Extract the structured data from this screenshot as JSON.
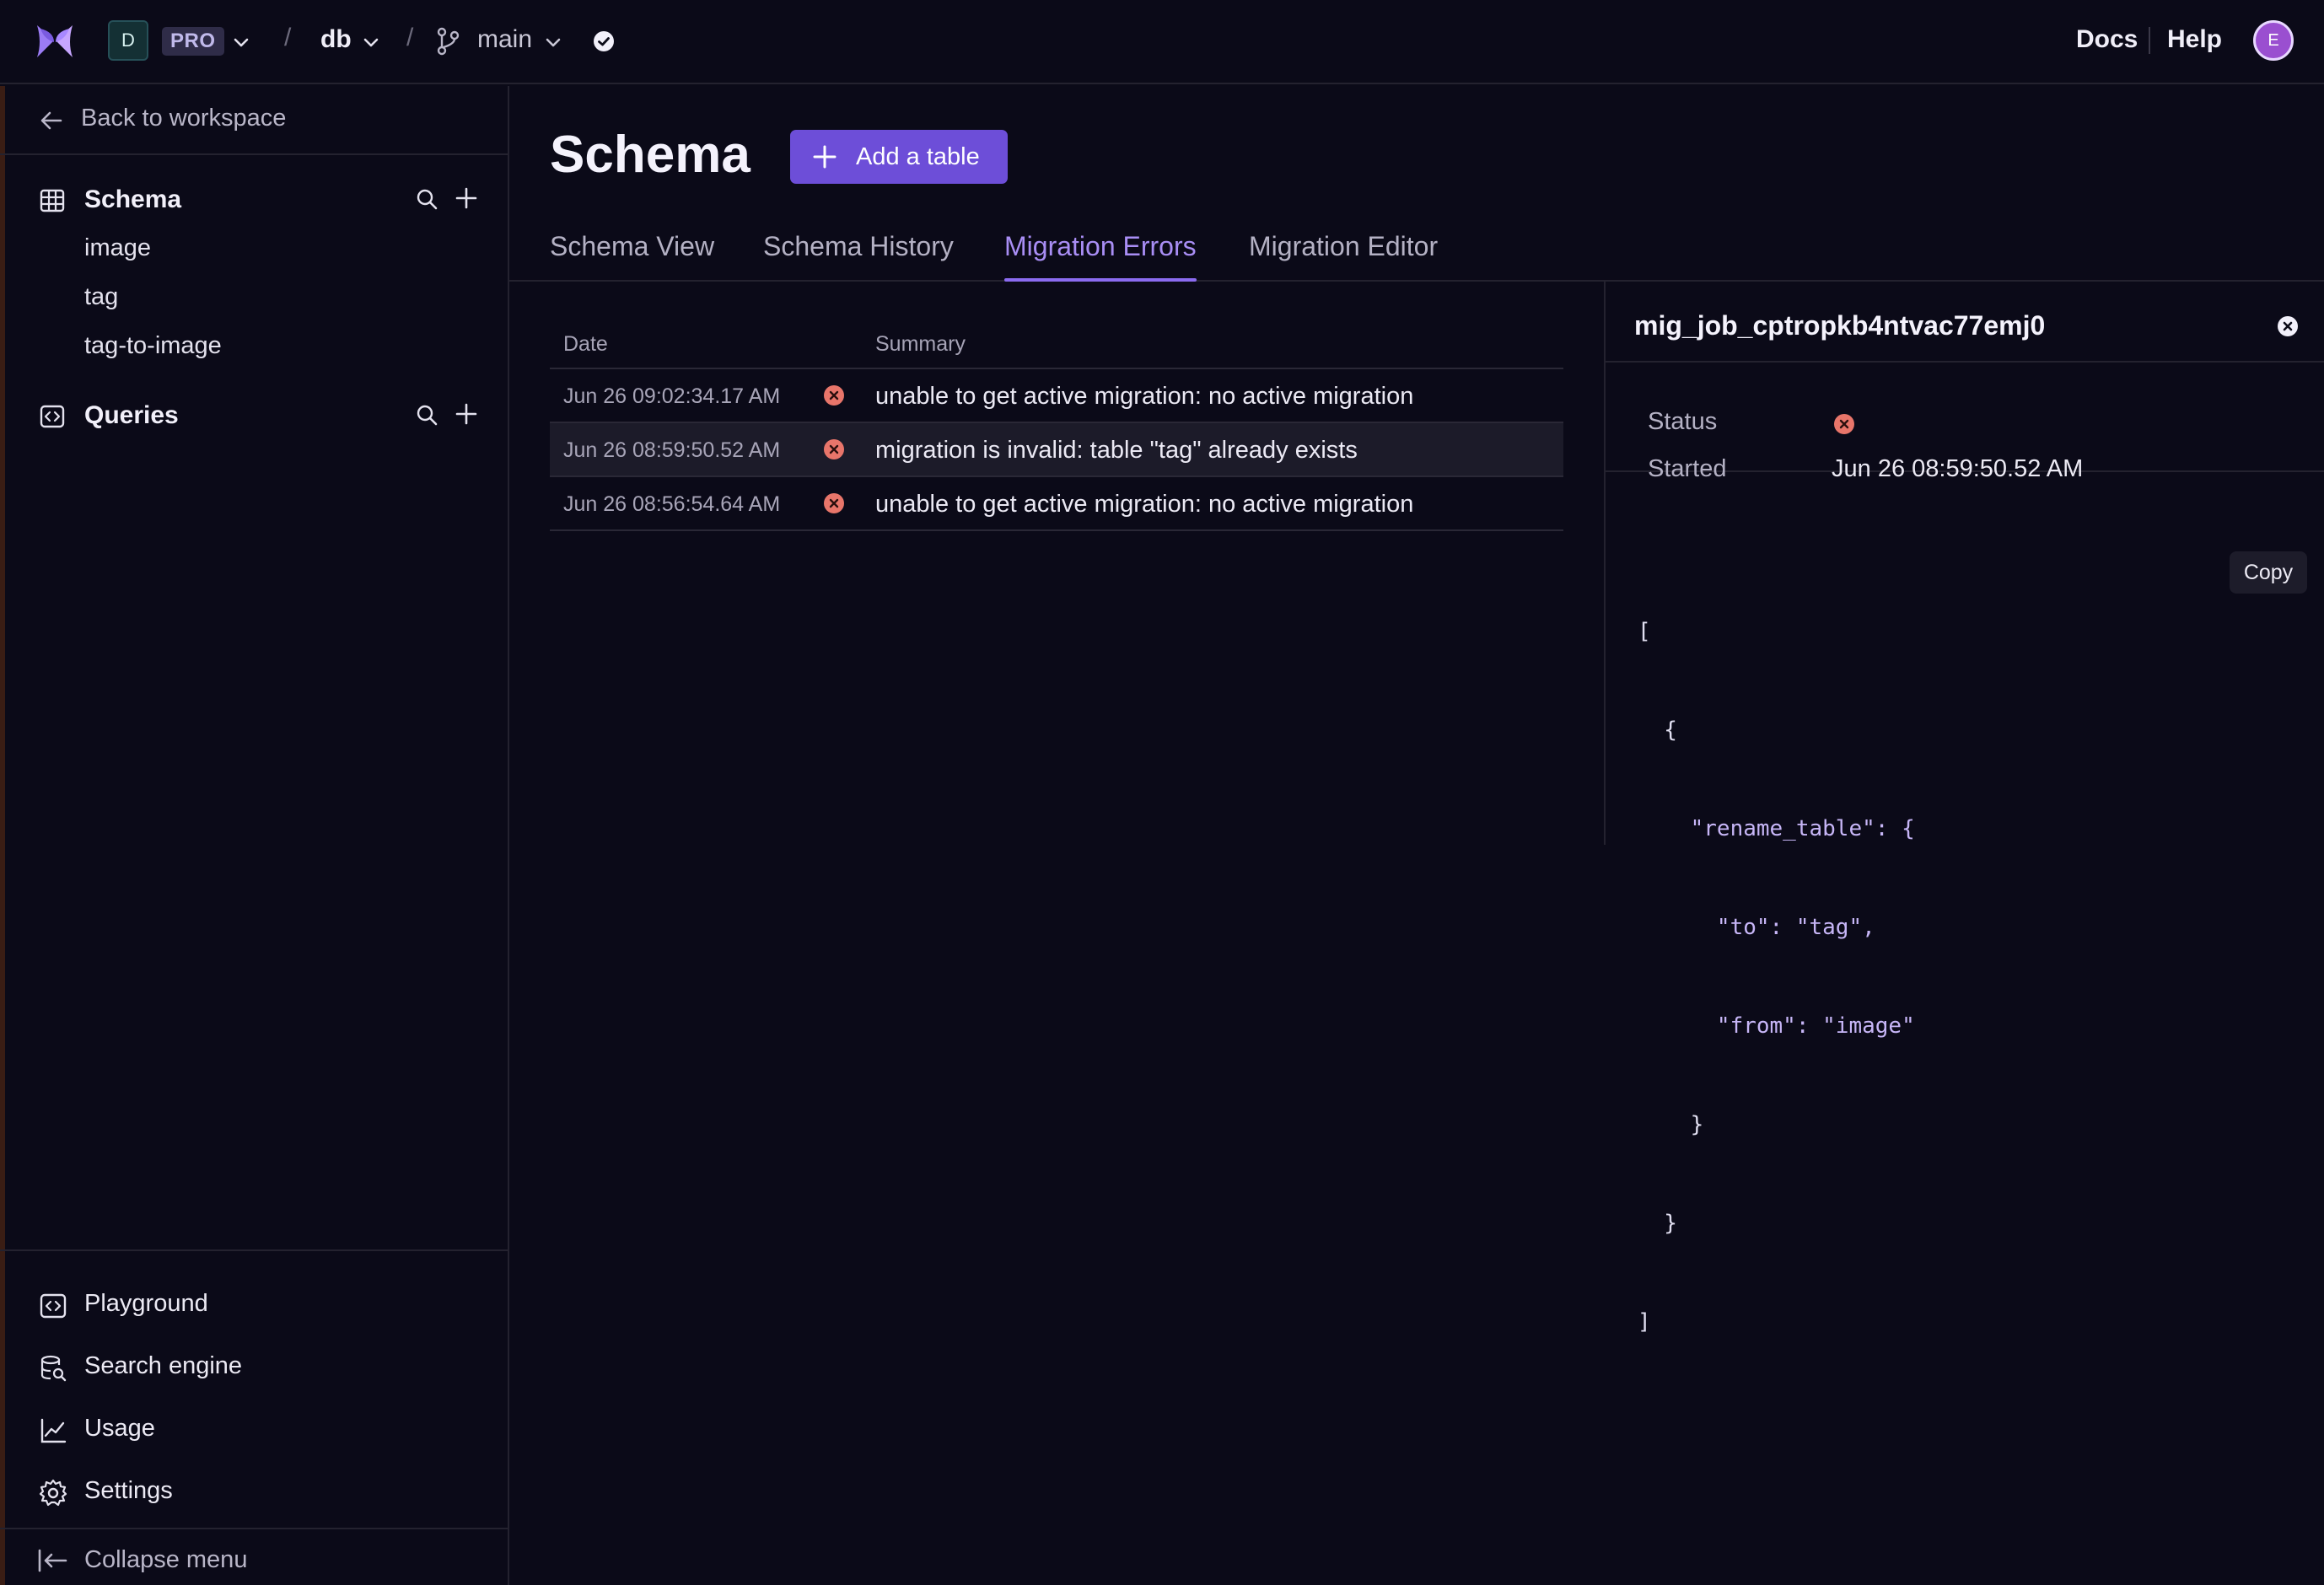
{
  "topbar": {
    "workspace_initial": "D",
    "plan_badge": "PRO",
    "database": "db",
    "branch": "main",
    "docs_label": "Docs",
    "help_label": "Help",
    "avatar_initial": "E",
    "separator": "/"
  },
  "sidebar": {
    "back_label": "Back to workspace",
    "schema": {
      "label": "Schema",
      "tables": [
        "image",
        "tag",
        "tag-to-image"
      ]
    },
    "queries": {
      "label": "Queries"
    },
    "bottom_nav": [
      {
        "label": "Playground",
        "icon": "code-box-icon"
      },
      {
        "label": "Search engine",
        "icon": "db-search-icon"
      },
      {
        "label": "Usage",
        "icon": "chart-line-icon"
      },
      {
        "label": "Settings",
        "icon": "gear-icon"
      }
    ],
    "collapse_label": "Collapse menu"
  },
  "main": {
    "title": "Schema",
    "add_table_label": "Add a table",
    "tabs": [
      {
        "label": "Schema View",
        "active": false
      },
      {
        "label": "Schema History",
        "active": false
      },
      {
        "label": "Migration Errors",
        "active": true
      },
      {
        "label": "Migration Editor",
        "active": false
      }
    ],
    "table": {
      "columns": [
        "Date",
        "Summary"
      ],
      "rows": [
        {
          "date": "Jun 26 09:02:34.17 AM",
          "status": "error",
          "summary": "unable to get active migration: no active migration"
        },
        {
          "date": "Jun 26 08:59:50.52 AM",
          "status": "error",
          "summary": "migration is invalid: table \"tag\" already exists"
        },
        {
          "date": "Jun 26 08:56:54.64 AM",
          "status": "error",
          "summary": "unable to get active migration: no active migration"
        }
      ]
    }
  },
  "panel": {
    "job_id": "mig_job_cptropkb4ntvac77emj0",
    "status_label": "Status",
    "status": "error",
    "started_label": "Started",
    "started_value": "Jun 26 08:59:50.52 AM",
    "copy_label": "Copy",
    "code_lines": [
      "[",
      "  {",
      "    \"rename_table\": {",
      "      \"to\": \"tag\",",
      "      \"from\": \"image\"",
      "    }",
      "  }",
      "]"
    ]
  },
  "colors": {
    "background": "#0b0a18",
    "accent": "#6d4ed8",
    "active_tab": "#a98ef5",
    "error": "#e8756a"
  }
}
